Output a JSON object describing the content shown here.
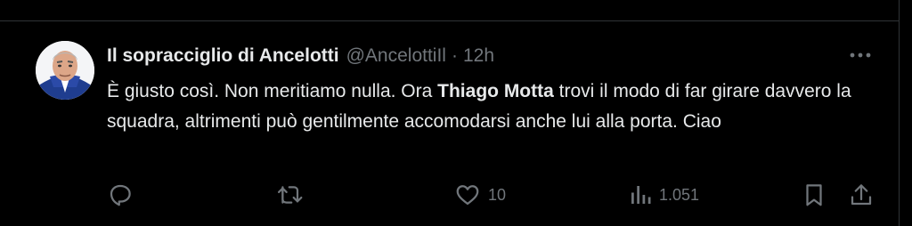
{
  "tweet": {
    "display_name": "Il sopracciglio di Ancelotti",
    "handle": "@AncelottiIl",
    "separator": "·",
    "time": "12h",
    "text_part1": "È giusto così. Non meritiamo nulla. Ora ",
    "text_bold": "Thiago Motta",
    "text_part2": " trovi il modo di far girare davvero la squadra, altrimenti può gentilmente accomodarsi anche lui alla porta. Ciao"
  },
  "actions": {
    "reply": {
      "icon": "reply-icon"
    },
    "retweet": {
      "icon": "retweet-icon"
    },
    "like": {
      "icon": "heart-icon",
      "count": "10"
    },
    "views": {
      "icon": "views-icon",
      "count": "1.051"
    },
    "bookmark": {
      "icon": "bookmark-icon"
    },
    "share": {
      "icon": "share-icon"
    }
  },
  "colors": {
    "background": "#000000",
    "text": "#e7e9ea",
    "secondary": "#71767b",
    "border": "#2f3336"
  }
}
